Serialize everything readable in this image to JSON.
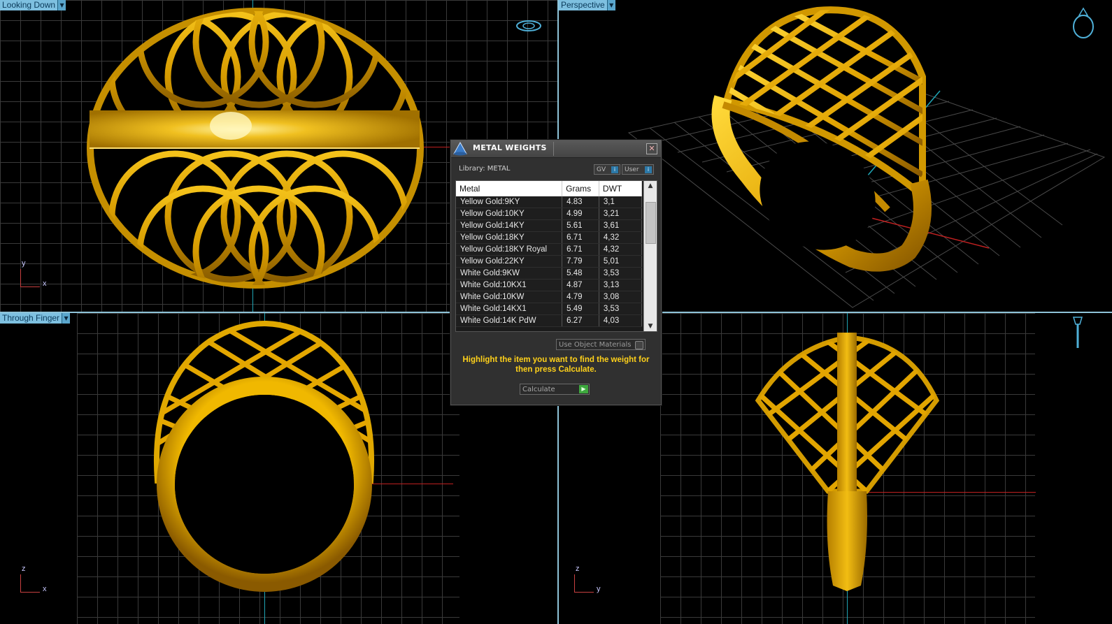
{
  "viewports": {
    "top_left": {
      "label": "Looking Down",
      "axis_x": "x",
      "axis_y": "y"
    },
    "top_right": {
      "label": "Perspective"
    },
    "bottom_left": {
      "label": "Through Finger",
      "axis_x": "x",
      "axis_y": "z"
    },
    "bottom_right": {
      "axis_x": "y",
      "axis_y": "z"
    }
  },
  "dialog": {
    "title": "METAL WEIGHTS",
    "library_label": "Library: METAL",
    "toggle_gv": "GV",
    "toggle_user": "User",
    "table": {
      "headers": [
        "Metal",
        "Grams",
        "DWT"
      ],
      "rows": [
        [
          "Yellow Gold:9KY",
          "4.83",
          "3,1"
        ],
        [
          "Yellow Gold:10KY",
          "4.99",
          "3,21"
        ],
        [
          "Yellow Gold:14KY",
          "5.61",
          "3,61"
        ],
        [
          "Yellow Gold:18KY",
          "6.71",
          "4,32"
        ],
        [
          "Yellow Gold:18KY Royal",
          "6.71",
          "4,32"
        ],
        [
          "Yellow Gold:22KY",
          "7.79",
          "5,01"
        ],
        [
          "White Gold:9KW",
          "5.48",
          "3,53"
        ],
        [
          "White Gold:10KX1",
          "4.87",
          "3,13"
        ],
        [
          "White Gold:10KW",
          "4.79",
          "3,08"
        ],
        [
          "White Gold:14KX1",
          "5.49",
          "3,53"
        ],
        [
          "White Gold:14K PdW",
          "6.27",
          "4,03"
        ]
      ]
    },
    "use_object_materials": "Use Object Materials",
    "hint": "Highlight the item you want to find the weight for then press Calculate.",
    "calculate_label": "Calculate"
  },
  "colors": {
    "gold": "#e8a800",
    "gold_light": "#ffd23a",
    "gold_dark": "#9a6a00",
    "grid": "#3a3a3a",
    "viewport_label_bg": "#7ec0e0",
    "hint_text": "#ffd11a"
  },
  "icons": {
    "dialog_logo": "cone-logo-icon",
    "close": "close-icon",
    "calculate": "play-icon",
    "view_cube_top": "ring-orientation-icon",
    "view_cube_side": "ring-side-orientation-icon"
  }
}
